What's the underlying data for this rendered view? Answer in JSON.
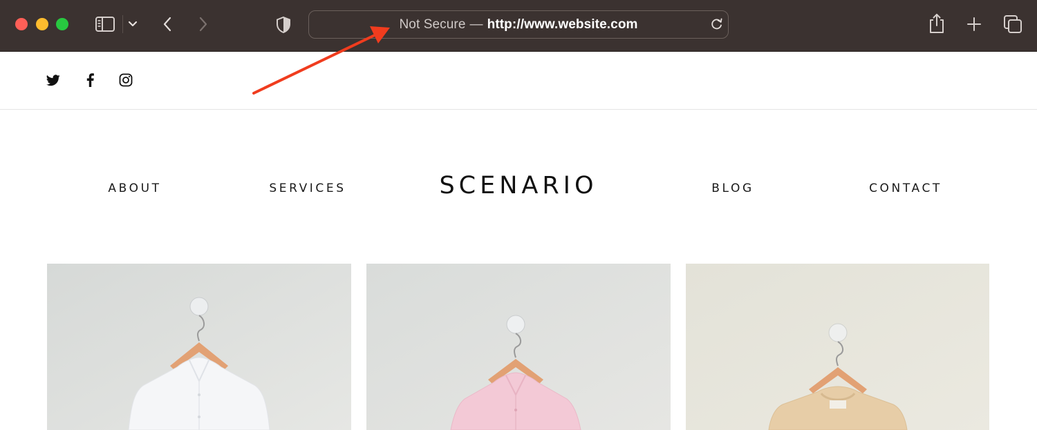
{
  "browser": {
    "address_bar": {
      "security_label": "Not Secure",
      "separator": "—",
      "url": "http://www.website.com"
    },
    "traffic_lights": {
      "close": "#fe5f57",
      "minimize": "#febc2e",
      "maximize": "#28c840"
    },
    "toolbar_color": "#3b3230",
    "icons": [
      "sidebar-icon",
      "chevron-down-icon",
      "back-icon",
      "forward-icon",
      "shield-icon",
      "reload-icon",
      "share-icon",
      "plus-icon",
      "tabs-overview-icon"
    ]
  },
  "social": {
    "icons": [
      "twitter-icon",
      "facebook-icon",
      "instagram-icon"
    ]
  },
  "nav": {
    "items": [
      {
        "label": "ABOUT"
      },
      {
        "label": "SERVICES"
      },
      {
        "label": "BLOG"
      },
      {
        "label": "CONTACT"
      }
    ],
    "logo": "SCENARIO"
  },
  "gallery": {
    "items": [
      {
        "subject": "white shirt on wooden hanger",
        "background": "#d9dbd8",
        "garment": "#f4f5f7"
      },
      {
        "subject": "pink shirt on wooden hanger",
        "background": "#dcdedb",
        "garment": "#f3c9d6"
      },
      {
        "subject": "beige t-shirt on wooden hanger",
        "background": "#e5e3d9",
        "garment": "#e7cda7"
      }
    ]
  },
  "annotation": {
    "color": "#f03c1e"
  }
}
